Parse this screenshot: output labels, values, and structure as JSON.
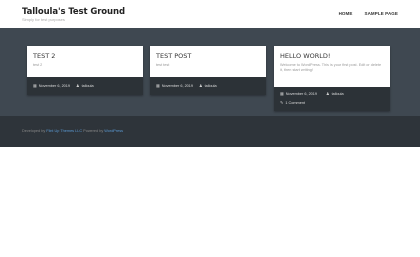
{
  "site": {
    "title": "Talloula's Test Ground",
    "description": "Simply for test purposes"
  },
  "nav": {
    "items": [
      {
        "label": "HOME"
      },
      {
        "label": "SAMPLE PAGE"
      }
    ]
  },
  "posts": [
    {
      "title": "TEST 2",
      "excerpt": "test 2",
      "date": "November 6, 2019",
      "author": "talloula",
      "comments": ""
    },
    {
      "title": "TEST POST",
      "excerpt": "test test",
      "date": "November 6, 2019",
      "author": "talloula",
      "comments": ""
    },
    {
      "title": "HELLO WORLD!",
      "excerpt": "Welcome to WordPress. This is your first post. Edit or delete it, then start writing!",
      "date": "November 6, 2019",
      "author": "talloula",
      "comments": "1 Comment"
    }
  ],
  "footer": {
    "prefix": "Developed by",
    "developer": "Flint Up Themes LLC",
    "middle": "Powered by",
    "platform": "WordPress"
  },
  "icons": {
    "date": "calendar-icon",
    "author": "user-icon",
    "comments": "comment-icon"
  }
}
